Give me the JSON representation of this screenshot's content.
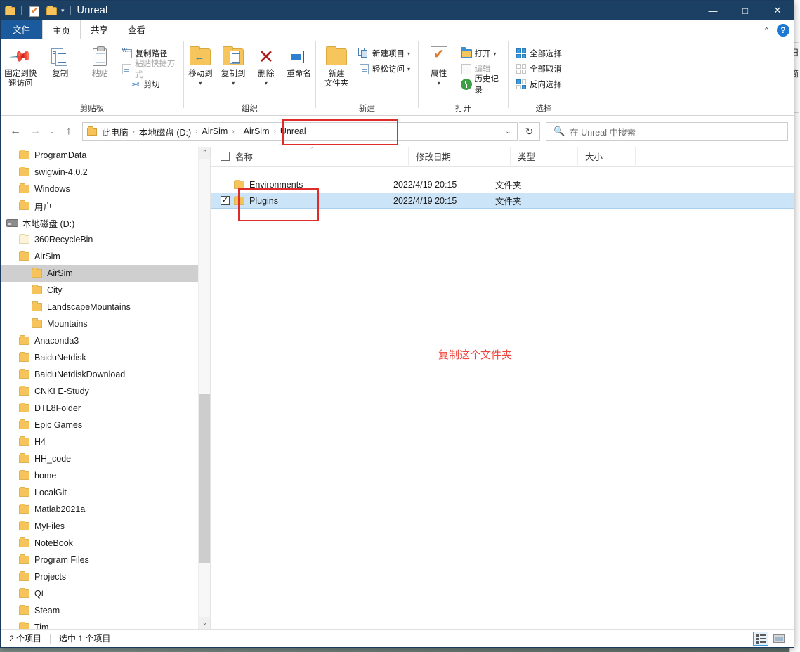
{
  "window": {
    "title": "Unreal",
    "quick_access_icons": [
      "folder-icon",
      "properties-icon",
      "folder-icon"
    ],
    "controls": {
      "minimize": "—",
      "maximize": "□",
      "close": "✕"
    }
  },
  "tabs": [
    {
      "label": "文件",
      "name": "tab-file"
    },
    {
      "label": "主页",
      "name": "tab-home"
    },
    {
      "label": "共享",
      "name": "tab-share"
    },
    {
      "label": "查看",
      "name": "tab-view"
    }
  ],
  "ribbon": {
    "collapse_label": "⌃",
    "help_label": "?",
    "groups": [
      {
        "label": "剪贴板",
        "big_buttons": [
          {
            "label": "固定到快\n速访问",
            "line1": "固定到快",
            "line2": "速访问",
            "icon": "pin-icon"
          },
          {
            "label": "复制",
            "icon": "copy-icon"
          },
          {
            "label": "粘贴",
            "icon": "paste-icon"
          }
        ],
        "small_items": [
          {
            "label": "复制路径",
            "icon": "copy-path-icon",
            "disabled": false
          },
          {
            "label": "粘贴快捷方式",
            "icon": "paste-shortcut-icon",
            "disabled": true
          },
          {
            "label": "剪切",
            "icon": "scissors-icon",
            "disabled": false
          }
        ]
      },
      {
        "label": "组织",
        "big_buttons": [
          {
            "label": "移动到",
            "icon": "move-to-icon",
            "dropdown": true
          },
          {
            "label": "复制到",
            "icon": "copy-to-icon",
            "dropdown": true
          },
          {
            "label": "删除",
            "icon": "delete-icon",
            "dropdown": true
          },
          {
            "label": "重命名",
            "icon": "rename-icon"
          }
        ]
      },
      {
        "label": "新建",
        "big_buttons": [
          {
            "line1": "新建",
            "line2": "文件夹",
            "label": "新建文件夹",
            "icon": "new-folder-icon"
          }
        ],
        "small_items": [
          {
            "label": "新建项目",
            "icon": "new-item-icon",
            "dropdown": true
          },
          {
            "label": "轻松访问",
            "icon": "easy-access-icon",
            "dropdown": true
          }
        ]
      },
      {
        "label": "打开",
        "big_buttons": [
          {
            "label": "属性",
            "icon": "properties-icon",
            "dropdown": true
          }
        ],
        "small_items": [
          {
            "label": "打开",
            "icon": "open-icon",
            "dropdown": true
          },
          {
            "label": "编辑",
            "icon": "edit-icon",
            "disabled": true
          },
          {
            "label": "历史记录",
            "icon": "history-icon"
          }
        ]
      },
      {
        "label": "选择",
        "small_items": [
          {
            "label": "全部选择",
            "icon": "select-all-icon"
          },
          {
            "label": "全部取消",
            "icon": "select-none-icon"
          },
          {
            "label": "反向选择",
            "icon": "invert-selection-icon"
          }
        ]
      }
    ]
  },
  "navigation": {
    "back": "←",
    "forward": "→",
    "recent": "⌄",
    "up": "↑",
    "refresh": "↻",
    "address_dropdown": "⌄"
  },
  "breadcrumb": {
    "items": [
      "此电脑",
      "本地磁盘 (D:)",
      "AirSim",
      "AirSim",
      "Unreal"
    ],
    "separator": "›",
    "highlighted_from_index": 3
  },
  "search": {
    "placeholder": "在 Unreal 中搜索",
    "icon": "search-icon"
  },
  "tree": [
    {
      "label": "ProgramData",
      "depth": 2,
      "icon": "folder-icon",
      "selected": false
    },
    {
      "label": "swigwin-4.0.2",
      "depth": 2,
      "icon": "folder-icon",
      "selected": false
    },
    {
      "label": "Windows",
      "depth": 2,
      "icon": "folder-icon",
      "selected": false
    },
    {
      "label": "用户",
      "depth": 2,
      "icon": "folder-icon",
      "selected": false
    },
    {
      "label": "本地磁盘 (D:)",
      "depth": 1,
      "icon": "drive-icon",
      "selected": false,
      "expanded": true
    },
    {
      "label": "360RecycleBin",
      "depth": 2,
      "icon": "folder-pale-icon",
      "selected": false
    },
    {
      "label": "AirSim",
      "depth": 2,
      "icon": "folder-icon",
      "selected": false
    },
    {
      "label": "AirSim",
      "depth": 3,
      "icon": "folder-icon",
      "selected": true
    },
    {
      "label": "City",
      "depth": 3,
      "icon": "folder-icon",
      "selected": false
    },
    {
      "label": "LandscapeMountains",
      "depth": 3,
      "icon": "folder-icon",
      "selected": false
    },
    {
      "label": "Mountains",
      "depth": 3,
      "icon": "folder-icon",
      "selected": false
    },
    {
      "label": "Anaconda3",
      "depth": 2,
      "icon": "folder-icon",
      "selected": false
    },
    {
      "label": "BaiduNetdisk",
      "depth": 2,
      "icon": "folder-icon",
      "selected": false
    },
    {
      "label": "BaiduNetdiskDownload",
      "depth": 2,
      "icon": "folder-icon",
      "selected": false
    },
    {
      "label": "CNKI E-Study",
      "depth": 2,
      "icon": "folder-icon",
      "selected": false
    },
    {
      "label": "DTL8Folder",
      "depth": 2,
      "icon": "folder-icon",
      "selected": false
    },
    {
      "label": "Epic Games",
      "depth": 2,
      "icon": "folder-icon",
      "selected": false
    },
    {
      "label": "H4",
      "depth": 2,
      "icon": "folder-icon",
      "selected": false
    },
    {
      "label": "HH_code",
      "depth": 2,
      "icon": "folder-icon",
      "selected": false
    },
    {
      "label": "home",
      "depth": 2,
      "icon": "folder-icon",
      "selected": false
    },
    {
      "label": "LocalGit",
      "depth": 2,
      "icon": "folder-icon",
      "selected": false
    },
    {
      "label": "Matlab2021a",
      "depth": 2,
      "icon": "folder-icon",
      "selected": false
    },
    {
      "label": "MyFiles",
      "depth": 2,
      "icon": "folder-icon",
      "selected": false
    },
    {
      "label": "NoteBook",
      "depth": 2,
      "icon": "folder-icon",
      "selected": false
    },
    {
      "label": "Program Files",
      "depth": 2,
      "icon": "folder-icon",
      "selected": false
    },
    {
      "label": "Projects",
      "depth": 2,
      "icon": "folder-icon",
      "selected": false
    },
    {
      "label": "Qt",
      "depth": 2,
      "icon": "folder-icon",
      "selected": false
    },
    {
      "label": "Steam",
      "depth": 2,
      "icon": "folder-icon",
      "selected": false
    },
    {
      "label": "Tim",
      "depth": 2,
      "icon": "folder-icon",
      "selected": false
    }
  ],
  "columns": [
    {
      "label": "名称",
      "sorted": true,
      "sort_dir": "asc",
      "sort_glyph": "⌃"
    },
    {
      "label": "修改日期",
      "sorted": false
    },
    {
      "label": "类型",
      "sorted": false
    },
    {
      "label": "大小",
      "sorted": false
    }
  ],
  "files": [
    {
      "name": "Environments",
      "date": "2022/4/19 20:15",
      "type": "文件夹",
      "size": "",
      "selected": false,
      "checked": false
    },
    {
      "name": "Plugins",
      "date": "2022/4/19 20:15",
      "type": "文件夹",
      "size": "",
      "selected": true,
      "checked": true
    }
  ],
  "annotations": {
    "note_text": "复制这个文件夹",
    "note_color": "#f0453d",
    "box_color": "#e02b2b"
  },
  "statusbar": {
    "item_count": "2 个项目",
    "selected_count": "选中 1 个项目",
    "views": [
      {
        "name": "details-view",
        "active": true
      },
      {
        "name": "large-icons-view",
        "active": false
      }
    ]
  }
}
